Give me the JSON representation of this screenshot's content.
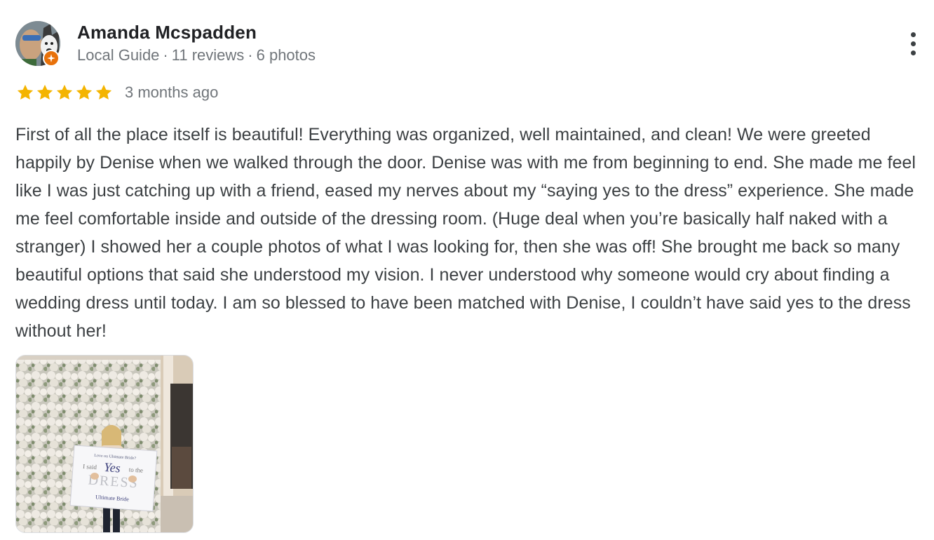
{
  "reviewer": {
    "name": "Amanda Mcspadden",
    "badge": "Local Guide",
    "reviews": "11 reviews",
    "photos": "6 photos",
    "separator": "·"
  },
  "rating": {
    "stars": 5,
    "max_stars": 5,
    "time": "3 months ago",
    "star_color": "#f4b400"
  },
  "review_text": "First of all the place itself is beautiful! Everything was organized, well maintained, and clean! We were greeted happily by Denise when we walked through the door. Denise was with me from beginning to end. She made me feel like I was just catching up with a friend, eased my nerves about my “saying yes to the dress” experience. She made me feel comfortable inside and outside of the dressing room. (Huge deal when you’re basically half naked with a stranger) I showed her a couple photos of what I was looking for, then she was off! She brought me back so many beautiful options that said she understood my vision. I never understood why someone would cry about finding a wedding dress until today. I am so blessed to have been matched with Denise, I couldn’t have said yes to the dress without her!",
  "photo": {
    "sign_text": {
      "top": "Love on Ultimate Bride?",
      "line1": "I said",
      "yes": "Yes",
      "line2": "to the",
      "dress": "DRESS",
      "brand": "Ultimate Bride"
    }
  },
  "icons": {
    "more": "more-vert-icon",
    "badge": "local-guide-icon",
    "star": "star-icon"
  },
  "colors": {
    "accent_badge": "#e8710a",
    "text_primary": "#202124",
    "text_secondary": "#70757a"
  }
}
